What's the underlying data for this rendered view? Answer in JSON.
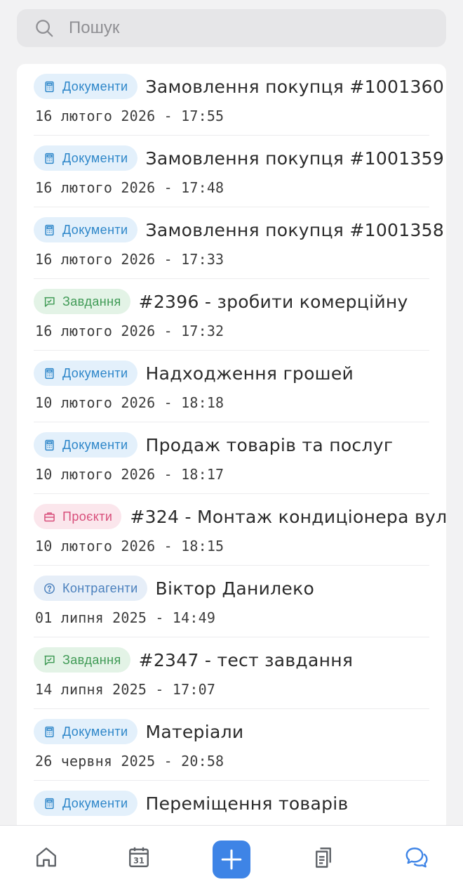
{
  "search": {
    "placeholder": "Пошук"
  },
  "items": [
    {
      "category": "Документи",
      "kind": "doc",
      "title": "Замовлення покупця #1001360",
      "date": "16 лютого 2026 - 17:55"
    },
    {
      "category": "Документи",
      "kind": "doc",
      "title": "Замовлення покупця #1001359",
      "date": "16 лютого 2026 - 17:48"
    },
    {
      "category": "Документи",
      "kind": "doc",
      "title": "Замовлення покупця #1001358",
      "date": "16 лютого 2026 - 17:33"
    },
    {
      "category": "Завдання",
      "kind": "task",
      "title": "#2396 - зробити комерційну",
      "date": "16 лютого 2026 - 17:32"
    },
    {
      "category": "Документи",
      "kind": "doc",
      "title": "Надходження грошей",
      "date": "10 лютого 2026 - 18:18"
    },
    {
      "category": "Документи",
      "kind": "doc",
      "title": "Продаж товарів та послуг",
      "date": "10 лютого 2026 - 18:17"
    },
    {
      "category": "Проєкти",
      "kind": "proj",
      "title": "#324 - Монтаж кондиціонера вул.",
      "date": "10 лютого 2026 - 18:15"
    },
    {
      "category": "Контрагенти",
      "kind": "contr",
      "title": "Віктор Данилеко",
      "date": "01 липня 2025 - 14:49"
    },
    {
      "category": "Завдання",
      "kind": "task",
      "title": "#2347 - тест завдання",
      "date": "14 липня 2025 - 17:07"
    },
    {
      "category": "Документи",
      "kind": "doc",
      "title": "Матеріали",
      "date": "26 червня 2025 - 20:58"
    },
    {
      "category": "Документи",
      "kind": "doc",
      "title": "Переміщення товарів",
      "date": ""
    }
  ],
  "nav": {
    "items": [
      "home-icon",
      "calendar-icon",
      "add-icon",
      "documents-icon",
      "chat-icon"
    ],
    "calendar_day": "31",
    "active": "chat-icon"
  },
  "colors": {
    "accent": "#3e84e6",
    "doc_badge": "#2d86c9",
    "task_badge": "#3f9a55",
    "project_badge": "#d84f7b",
    "contractor_badge": "#4a80bd"
  }
}
